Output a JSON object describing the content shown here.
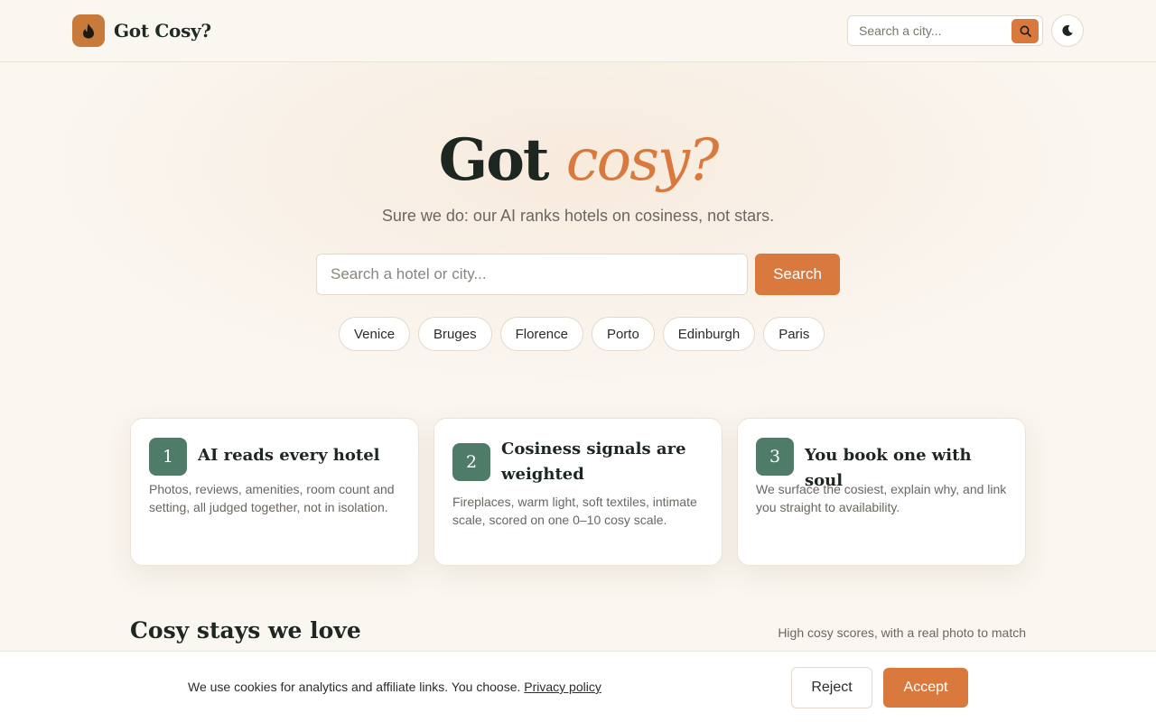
{
  "header": {
    "brand": "Got Cosy?",
    "search_placeholder": "Search a city...",
    "logo_icon": "flame-icon",
    "search_icon": "search-icon",
    "theme_icon": "moon-icon"
  },
  "hero": {
    "title_main": "Got",
    "title_accent": "cosy?",
    "subtitle": "Sure we do: our AI ranks hotels on cosiness, not stars.",
    "search_placeholder": "Search a hotel or city...",
    "search_button": "Search",
    "cities": [
      "Venice",
      "Bruges",
      "Florence",
      "Porto",
      "Edinburgh",
      "Paris"
    ]
  },
  "steps": [
    {
      "num": "1",
      "title": "AI reads every hotel",
      "desc": "Photos, reviews, amenities, room count and setting, all judged together, not in isolation."
    },
    {
      "num": "2",
      "title": "Cosiness signals are weighted",
      "desc": "Fireplaces, warm light, soft textiles, intimate scale, scored on one 0–10 cosy scale."
    },
    {
      "num": "3",
      "title": "You book one with soul",
      "desc": "We surface the cosiest, explain why, and link you straight to availability."
    }
  ],
  "section": {
    "title": "Cosy stays we love",
    "subtitle": "High cosy scores, with a real photo to match"
  },
  "cookie": {
    "text": "We use cookies for analytics and affiliate links. You choose.",
    "link": "Privacy policy",
    "reject": "Reject",
    "accept": "Accept"
  },
  "colors": {
    "accent": "#d9793e",
    "brand_logo": "#c77a3a",
    "step_badge": "#4e7c68",
    "background": "#faf6f0"
  }
}
